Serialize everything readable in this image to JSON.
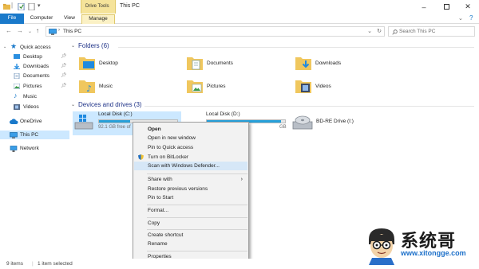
{
  "titlebar": {
    "title": "This PC",
    "context_tab": "Drive Tools"
  },
  "ribbon": {
    "tabs": [
      {
        "label": "File"
      },
      {
        "label": "Computer"
      },
      {
        "label": "View"
      },
      {
        "label": "Manage"
      }
    ]
  },
  "address": {
    "path": "This PC",
    "search_placeholder": "Search This PC"
  },
  "sidebar": {
    "items": [
      {
        "label": "Quick access",
        "icon": "star-icon"
      },
      {
        "label": "Desktop",
        "icon": "desktop-folder-icon",
        "pinned": true
      },
      {
        "label": "Downloads",
        "icon": "downloads-icon",
        "pinned": true
      },
      {
        "label": "Documents",
        "icon": "documents-icon",
        "pinned": true
      },
      {
        "label": "Pictures",
        "icon": "pictures-icon",
        "pinned": true
      },
      {
        "label": "Music",
        "icon": "music-icon"
      },
      {
        "label": "Videos",
        "icon": "videos-icon"
      },
      {
        "label": "OneDrive",
        "icon": "cloud-icon"
      },
      {
        "label": "This PC",
        "icon": "computer-icon"
      },
      {
        "label": "Network",
        "icon": "network-icon"
      }
    ]
  },
  "content": {
    "folders_header": "Folders (6)",
    "folders": [
      {
        "label": "Desktop",
        "icon": "desktop-folder-icon"
      },
      {
        "label": "Documents",
        "icon": "documents-folder-icon"
      },
      {
        "label": "Downloads",
        "icon": "downloads-folder-icon"
      },
      {
        "label": "Music",
        "icon": "music-folder-icon"
      },
      {
        "label": "Pictures",
        "icon": "pictures-folder-icon"
      },
      {
        "label": "Videos",
        "icon": "videos-folder-icon"
      }
    ],
    "drives_header": "Devices and drives (3)",
    "drives": [
      {
        "name": "Local Disk (C:)",
        "free": "92.1 GB free of",
        "used_fraction": 0.4
      },
      {
        "name": "Local Disk (D:)",
        "free": "GB",
        "used_fraction": 0.95
      },
      {
        "name": "BD-RE Drive (I:)"
      }
    ]
  },
  "context_menu": {
    "items": [
      {
        "label": "Open",
        "bold": true
      },
      {
        "label": "Open in new window"
      },
      {
        "label": "Pin to Quick access"
      },
      {
        "label": "Turn on BitLocker",
        "icon": "shield-icon"
      },
      {
        "label": "Scan with Windows Defender...",
        "highlighted": true
      },
      {
        "label": "Share with",
        "submenu": true
      },
      {
        "label": "Restore previous versions"
      },
      {
        "label": "Pin to Start"
      },
      {
        "label": "Format..."
      },
      {
        "label": "Copy"
      },
      {
        "label": "Create shortcut"
      },
      {
        "label": "Rename"
      },
      {
        "label": "Properties"
      }
    ]
  },
  "statusbar": {
    "items_count": "9 items",
    "selected": "1 item selected"
  },
  "watermark": {
    "brand_cn": "系统哥",
    "url": "www.xitongge.com"
  },
  "colors": {
    "accent": "#1979ca",
    "selection": "#cce8ff",
    "context_tab": "#f5e39a",
    "drive_bar": "#26a0da"
  }
}
